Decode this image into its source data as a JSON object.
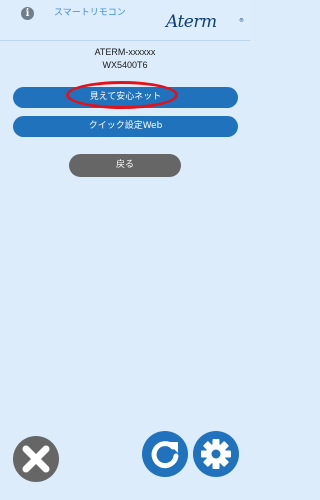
{
  "header": {
    "info_icon": "info-icon",
    "title": "スマートリモコン",
    "logo_text": "Aterm",
    "logo_mark": "®"
  },
  "device": {
    "name": "ATERM-xxxxxx",
    "model": "WX5400T6"
  },
  "menu": {
    "mieru_anshin_net": "見えて安心ネット",
    "quick_settings_web": "クイック設定Web",
    "back": "戻る"
  },
  "footer": {
    "close_icon": "close-icon",
    "reload_icon": "reload-icon",
    "settings_icon": "gear-icon"
  },
  "colors": {
    "background": "#dcecfb",
    "primary_button": "#1f72bb",
    "secondary_button": "#666666",
    "highlight": "#e3121a",
    "title_text": "#3d8ed6",
    "logo": "#0d3f78"
  }
}
